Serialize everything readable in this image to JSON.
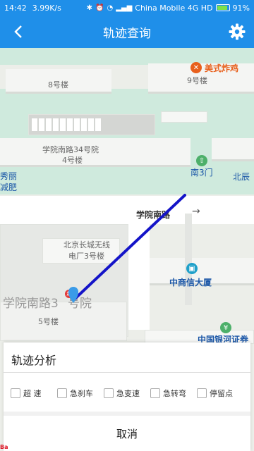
{
  "status_bar": {
    "time": "14:42",
    "speed": "3.99K/s",
    "carrier": "China Mobile 4G HD",
    "battery": "91%",
    "battery_level": 0.91
  },
  "header": {
    "title": "轨迹查询",
    "back_icon": "chevron-left-icon",
    "settings_icon": "gear-icon"
  },
  "map": {
    "labels": {
      "building_8": "8号楼",
      "building_9": "9号楼",
      "meishi": "美式炸鸡",
      "xueyuan34": "学院南路34号院",
      "building_4": "4号楼",
      "xiuli": "秀丽",
      "jianfei": "减肥",
      "nan3men": "南3门",
      "beichen": "北辰",
      "road_name": "学院南路",
      "changcheng": "北京长城无线",
      "dianchang": "电厂3号楼",
      "zhongshang": "中商信大厦",
      "xueyuan3x": "学院南路3",
      "hao_yuan": "号院",
      "building_5": "5号楼",
      "bank": "中国银河证券"
    },
    "track_color": "#1414c8"
  },
  "sheet": {
    "title": "轨迹分析",
    "options": [
      "超  速",
      "急刹车",
      "急变速",
      "急转弯",
      "停留点"
    ],
    "cancel": "取消"
  }
}
